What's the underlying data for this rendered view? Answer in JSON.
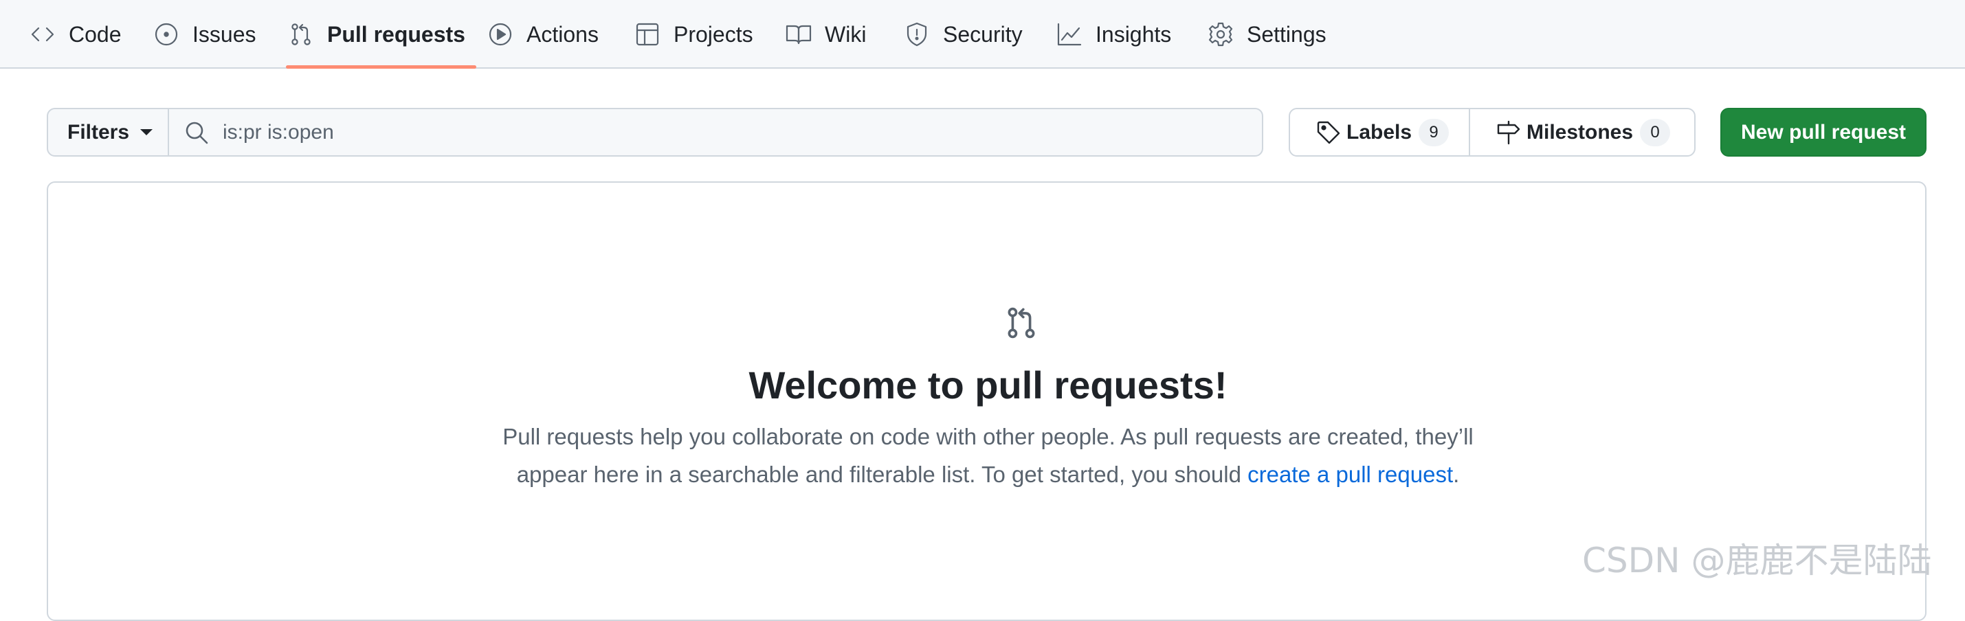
{
  "repo_nav": {
    "tabs": [
      {
        "label": "Code",
        "icon": "code-icon"
      },
      {
        "label": "Issues",
        "icon": "issue-opened-icon"
      },
      {
        "label": "Pull requests",
        "icon": "git-pull-request-icon",
        "selected": true
      },
      {
        "label": "Actions",
        "icon": "play-icon"
      },
      {
        "label": "Projects",
        "icon": "table-icon"
      },
      {
        "label": "Wiki",
        "icon": "book-icon"
      },
      {
        "label": "Security",
        "icon": "shield-icon"
      },
      {
        "label": "Insights",
        "icon": "graph-icon"
      },
      {
        "label": "Settings",
        "icon": "gear-icon"
      }
    ],
    "selected_underline_color": "#fd8c73"
  },
  "toolbar": {
    "filters_label": "Filters",
    "search_value": "is:pr is:open",
    "labels_label": "Labels",
    "labels_count": "9",
    "milestones_label": "Milestones",
    "milestones_count": "0",
    "new_pr_label": "New pull request",
    "new_pr_color": "#1f883d"
  },
  "blankslate": {
    "icon": "git-pull-request-icon",
    "title": "Welcome to pull requests!",
    "description_line1": "Pull requests help you collaborate on code with other people. As pull requests are created, they’ll",
    "description_line2_prefix": "appear here in a searchable and filterable list. To get started, you should ",
    "description_link": "create a pull request",
    "description_suffix": ".",
    "link_color": "#0969da"
  },
  "watermark": "CSDN @鹿鹿不是陆陆"
}
